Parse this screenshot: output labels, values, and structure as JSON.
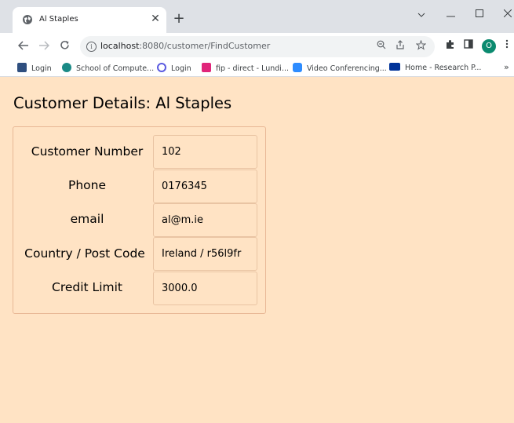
{
  "browser": {
    "tab_title": "Al Staples",
    "url_host": "localhost",
    "url_path": ":8080/customer/FindCustomer",
    "profile_initial": "O",
    "new_tab_glyph": "+",
    "tab_close_glyph": "✕",
    "bookmarks": [
      {
        "label": "Login",
        "icon": "bookmark-login-icon",
        "color": "#2f4f7f"
      },
      {
        "label": "School of Compute...",
        "icon": "bookmark-school-icon",
        "color": "#1a8a86"
      },
      {
        "label": "Login",
        "icon": "bookmark-login-circle-icon",
        "color": "#5b5be0"
      },
      {
        "label": "fip - direct - Lundi...",
        "icon": "bookmark-fip-icon",
        "color": "#e0257a"
      },
      {
        "label": "Video Conferencing...",
        "icon": "bookmark-zoom-icon",
        "color": "#2d8cff"
      },
      {
        "label": "Home - Research P...",
        "icon": "bookmark-eu-icon",
        "color": "#003399"
      }
    ],
    "bookmarks_overflow": "»"
  },
  "page": {
    "background": "#ffe3c4",
    "title": "Customer Details: Al Staples",
    "fields": [
      {
        "label": "Customer Number",
        "value": "102"
      },
      {
        "label": "Phone",
        "value": "0176345"
      },
      {
        "label": "email",
        "value": "al@m.ie"
      },
      {
        "label": "Country / Post Code",
        "value": "Ireland / r56l9fr"
      },
      {
        "label": "Credit Limit",
        "value": "3000.0"
      }
    ]
  }
}
